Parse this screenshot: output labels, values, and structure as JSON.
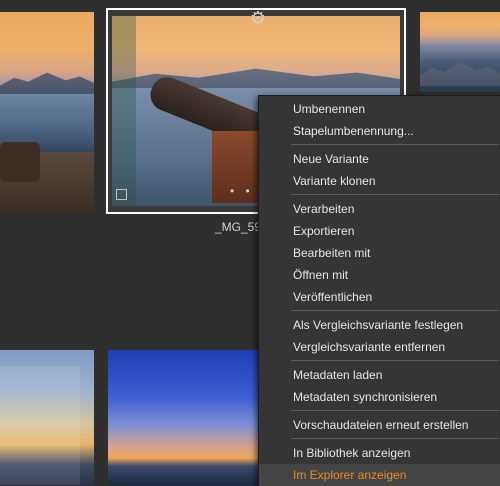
{
  "selected_thumbnail": {
    "filename": "_MG_59",
    "dots": "• • •",
    "gear_icon": "⚙"
  },
  "context_menu": {
    "items": [
      {
        "label": "Umbenennen"
      },
      {
        "label": "Stapelumbenennung..."
      },
      {
        "label": "Neue Variante"
      },
      {
        "label": "Variante klonen"
      },
      {
        "label": "Verarbeiten"
      },
      {
        "label": "Exportieren"
      },
      {
        "label": "Bearbeiten mit"
      },
      {
        "label": "Öffnen mit"
      },
      {
        "label": "Veröffentlichen"
      },
      {
        "label": "Als Vergleichsvariante festlegen"
      },
      {
        "label": "Vergleichsvariante entfernen"
      },
      {
        "label": "Metadaten laden"
      },
      {
        "label": "Metadaten synchronisieren"
      },
      {
        "label": "Vorschaudateien erneut erstellen"
      },
      {
        "label": "In Bibliothek anzeigen"
      },
      {
        "label": "Im Explorer anzeigen"
      }
    ],
    "active_item": "Im Explorer anzeigen",
    "highlight_color": "#f08a1c"
  }
}
